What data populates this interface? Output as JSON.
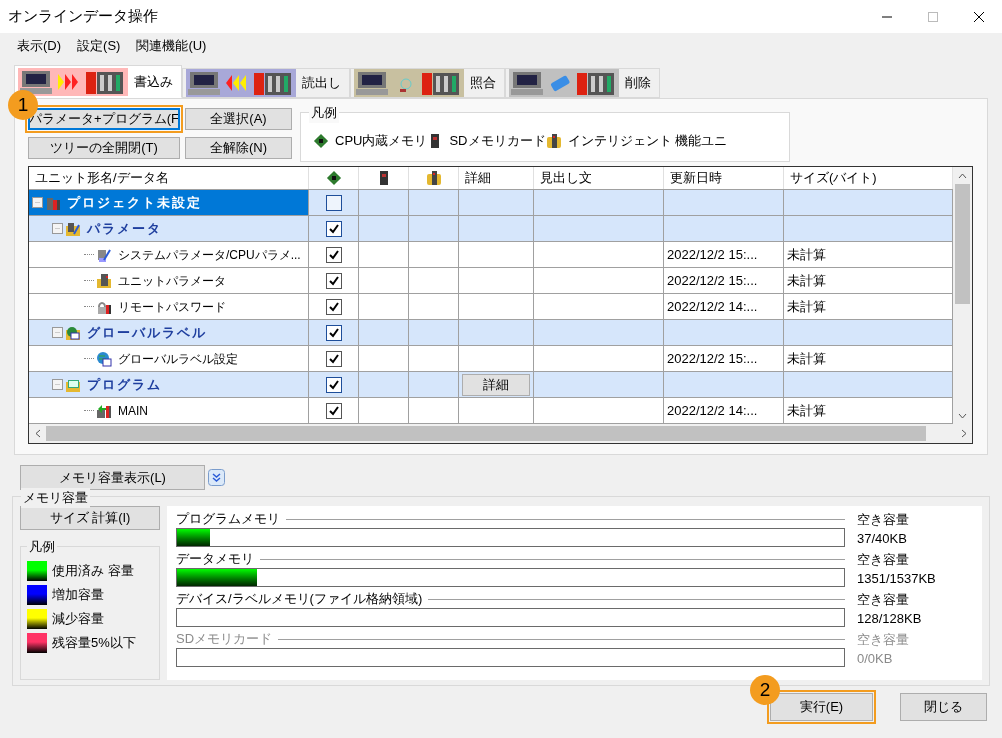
{
  "window": {
    "title": "オンラインデータ操作"
  },
  "menu": [
    "表示(D)",
    "設定(S)",
    "関連機能(U)"
  ],
  "tabs": [
    {
      "label": "書込み",
      "kind": "write",
      "selected": true
    },
    {
      "label": "読出し",
      "kind": "read",
      "selected": false
    },
    {
      "label": "照合",
      "kind": "verify",
      "selected": false
    },
    {
      "label": "削除",
      "kind": "delete",
      "selected": false
    }
  ],
  "tree_buttons": [
    {
      "label": "パラメータ+プログラム(F",
      "focused": true,
      "callout": "1"
    },
    {
      "label": "全選択(A)",
      "focused": false
    },
    {
      "label": "ツリーの全開閉(T)",
      "focused": false
    },
    {
      "label": "全解除(N)",
      "focused": false
    }
  ],
  "legend": {
    "title": "凡例",
    "items": [
      {
        "kind": "cpu-memory",
        "label": "CPU内蔵メモリ"
      },
      {
        "kind": "sd-card",
        "label": "SDメモリカード"
      },
      {
        "kind": "intelligent-unit",
        "label": "インテリジェント 機能ユニ"
      }
    ]
  },
  "table": {
    "columns": [
      {
        "kind": "text",
        "label": "ユニット形名/データ名"
      },
      {
        "kind": "cpu-memory"
      },
      {
        "kind": "sd-card"
      },
      {
        "kind": "intelligent-unit"
      },
      {
        "kind": "text",
        "label": "詳細"
      },
      {
        "kind": "text",
        "label": "見出し文"
      },
      {
        "kind": "text",
        "label": "更新日時"
      },
      {
        "kind": "text",
        "label": "サイズ(バイト)"
      }
    ],
    "rows": [
      {
        "name": "プロジェクト未設定",
        "kind": "project",
        "selected": true,
        "expanded": true,
        "checked": false,
        "children": [
          {
            "name": "パラメータ",
            "kind": "parameter",
            "selected": false,
            "expanded": true,
            "checked": true,
            "children": [
              {
                "name": "システムパラメータ/CPUパラメ...",
                "kind": "system-parameter",
                "selected": false,
                "checked": true,
                "updated": "2022/12/2 15:...",
                "size": "未計算"
              },
              {
                "name": "ユニットパラメータ",
                "kind": "unit-parameter",
                "selected": false,
                "checked": true,
                "updated": "2022/12/2 15:...",
                "size": "未計算"
              },
              {
                "name": "リモートパスワード",
                "kind": "password",
                "selected": false,
                "checked": true,
                "updated": "2022/12/2 14:...",
                "size": "未計算"
              }
            ]
          },
          {
            "name": "グローバルラベル",
            "kind": "label",
            "selected": false,
            "expanded": true,
            "checked": true,
            "children": [
              {
                "name": "グローバルラベル設定",
                "kind": "label-setting",
                "selected": false,
                "checked": true,
                "updated": "2022/12/2 15:...",
                "size": "未計算"
              }
            ]
          },
          {
            "name": "プログラム",
            "kind": "program",
            "selected": false,
            "expanded": true,
            "checked": true,
            "detail": "詳細",
            "children": [
              {
                "name": "MAIN",
                "kind": "program-file",
                "selected": false,
                "checked": true,
                "updated": "2022/12/2 14:...",
                "size": "未計算"
              }
            ]
          }
        ]
      }
    ]
  },
  "memory": {
    "toggle": "メモリ容量表示(L)",
    "title": "メモリ容量",
    "calc_button": "サイズ 計算(I)",
    "legend": {
      "title": "凡例",
      "items": [
        {
          "label": "使用済み 容量",
          "color": "#00ff00"
        },
        {
          "label": "増加容量",
          "color": "#0000ff"
        },
        {
          "label": "減少容量",
          "color": "#ffff00"
        },
        {
          "label": "残容量5%以下",
          "color": "#ff3366"
        }
      ]
    },
    "bars": [
      {
        "label": "プログラムメモリ",
        "level": 0.05,
        "free_label": "空き容量",
        "free": "37/40KB",
        "disabled": false
      },
      {
        "label": "データメモリ",
        "level": 0.12,
        "free_label": "空き容量",
        "free": "1351/1537KB",
        "disabled": false
      },
      {
        "label": "デバイス/ラベルメモリ(ファイル格納領域)",
        "free_label": "空き容量",
        "free": "128/128KB",
        "disabled": false
      },
      {
        "label": "SDメモリカード",
        "free_label": "空き容量",
        "free": "0/0KB",
        "disabled": true
      }
    ]
  },
  "buttons": [
    {
      "label": "実行(E)",
      "callout": "2"
    },
    {
      "label": "閉じる"
    }
  ]
}
